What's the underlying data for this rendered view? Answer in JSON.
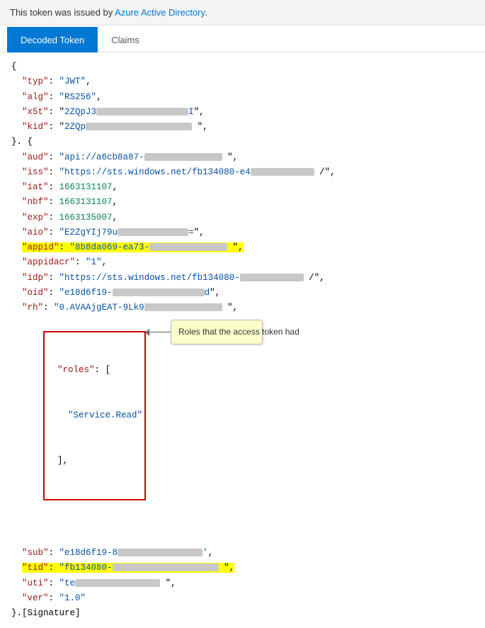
{
  "topbar": {
    "text": "This token was issued by ",
    "link_text": "Azure Active Directory",
    "link_suffix": "."
  },
  "tabs": [
    {
      "label": "Decoded Token",
      "active": true
    },
    {
      "label": "Claims",
      "active": false
    }
  ],
  "tooltip": {
    "text": "Roles that the access token had"
  },
  "token": {
    "open_brace": "{",
    "typ_key": "\"typ\"",
    "typ_val": "\"JWT\"",
    "alg_key": "\"alg\"",
    "alg_val": "\"RS256\"",
    "x5t_key": "\"x5t\"",
    "kid_key": "\"kid\"",
    "close_open": "}. {",
    "aud_key": "\"aud\"",
    "aud_val_prefix": "\"api://a6cb8a87-",
    "aud_val_suffix": "\"",
    "iss_key": "\"iss\"",
    "iss_val_prefix": "\"https://sts.windows.net/fb134080-e4",
    "iss_val_suffix": "/\"",
    "iat_key": "\"iat\"",
    "iat_val": "1663131107",
    "nbf_key": "\"nbf\"",
    "nbf_val": "1663131107",
    "exp_key": "\"exp\"",
    "exp_val": "1663135007",
    "aio_key": "\"aio\"",
    "aio_val_prefix": "\"E2ZgYIj79u",
    "aio_val_suffix": "=\"",
    "appid_key": "\"appid\"",
    "appid_val_prefix": "\"8b8da069-ea73-",
    "appid_val_suffix": "\"",
    "appidacr_key": "\"appidacr\"",
    "appidacr_val": "\"1\"",
    "idp_key": "\"idp\"",
    "idp_val_prefix": "\"https://sts.windows.net/fb134080-",
    "idp_val_suffix": "/\"",
    "oid_key": "\"oid\"",
    "oid_val_prefix": "\"e18d6f19-",
    "oid_val_suffix": "d\"",
    "rh_key": "\"rh\"",
    "rh_val_prefix": "\"0.AVAAjgEAT-9Lk9",
    "rh_val_suffix": "\"",
    "roles_key": "\"roles\"",
    "roles_open": "[",
    "roles_val": "\"Service.Read\"",
    "roles_close": "],",
    "sub_key": "\"sub\"",
    "sub_val_prefix": "\"e18d6f19-8",
    "sub_val_suffix": "'",
    "tid_key": "\"tid\"",
    "tid_val_prefix": "\"fb134080-",
    "tid_val_suffix": "\"",
    "uti_key": "\"uti\"",
    "uti_val_prefix": "\"te",
    "uti_val_suffix": "\"",
    "ver_key": "\"ver\"",
    "ver_val": "\"1.0\"",
    "close_sig": "}.[Signature]"
  }
}
